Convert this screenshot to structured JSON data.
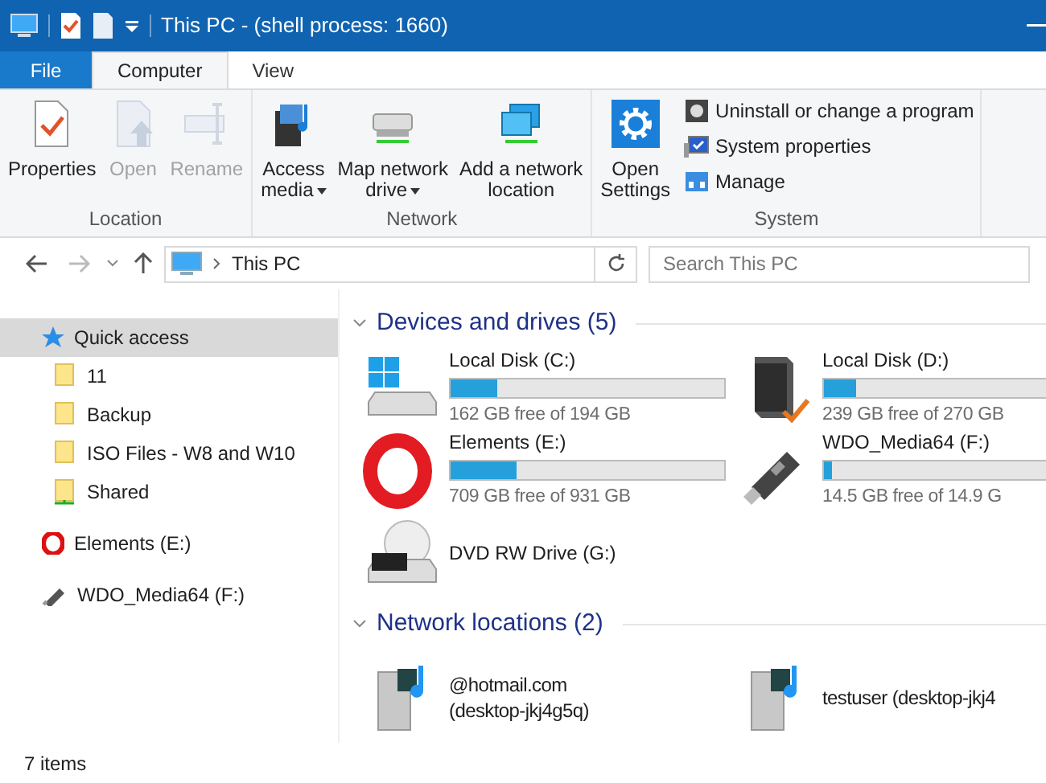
{
  "title_bar": {
    "title": "This PC - (shell process: 1660)"
  },
  "ribbon_tabs": [
    {
      "label": "File",
      "kind": "file",
      "selected": false
    },
    {
      "label": "Computer",
      "kind": "tab",
      "selected": true
    },
    {
      "label": "View",
      "kind": "tab",
      "selected": false
    }
  ],
  "ribbon_groups": [
    {
      "label": "Location",
      "buttons": [
        {
          "lines": [
            "Properties"
          ],
          "disabled": false,
          "dropdown": false
        },
        {
          "lines": [
            "Open"
          ],
          "disabled": true,
          "dropdown": false
        },
        {
          "lines": [
            "Rename"
          ],
          "disabled": true,
          "dropdown": false
        }
      ]
    },
    {
      "label": "Network",
      "buttons": [
        {
          "lines": [
            "Access",
            "media"
          ],
          "disabled": false,
          "dropdown": true
        },
        {
          "lines": [
            "Map network",
            "drive"
          ],
          "disabled": false,
          "dropdown": true
        },
        {
          "lines": [
            "Add a network",
            "location"
          ],
          "disabled": false,
          "dropdown": false
        }
      ]
    },
    {
      "label": "System",
      "buttons": [
        {
          "lines": [
            "Open",
            "Settings"
          ],
          "disabled": false,
          "dropdown": false
        }
      ],
      "small_buttons": [
        "Uninstall or change a program",
        "System properties",
        "Manage"
      ]
    }
  ],
  "address_bar": {
    "path": "This PC",
    "search_placeholder": "Search This PC"
  },
  "nav_pane": [
    {
      "label": "Quick access",
      "selected": true,
      "children": [
        {
          "label": "11",
          "selected": false
        },
        {
          "label": "Backup",
          "selected": false
        },
        {
          "label": "ISO Files - W8 and W10",
          "selected": false
        },
        {
          "label": "Shared",
          "selected": false
        }
      ]
    },
    {
      "label": "Elements (E:)",
      "selected": false
    },
    {
      "label": "WDO_Media64 (F:)",
      "selected": false
    }
  ],
  "sections": [
    {
      "title": "Devices and drives (5)",
      "items": [
        {
          "kind": "disk",
          "name": "Local Disk (C:)",
          "free": "162 GB free of 194 GB",
          "level": 0.17
        },
        {
          "kind": "disk",
          "name": "Local Disk (D:)",
          "free": "239 GB free of 270 GB",
          "level": 0.115
        },
        {
          "kind": "disk",
          "name": "Elements (E:)",
          "free": "709 GB free of 931 GB",
          "level": 0.24
        },
        {
          "kind": "disk",
          "name": "WDO_Media64 (F:)",
          "free": "14.5 GB free of 14.9 G",
          "level": 0.03
        },
        {
          "kind": "optical",
          "name": "DVD RW Drive (G:)"
        }
      ]
    },
    {
      "title": "Network locations (2)",
      "items": [
        {
          "kind": "network",
          "lines": [
            "@hotmail.com",
            "(desktop-jkj4g5q)"
          ]
        },
        {
          "kind": "network",
          "lines": [
            "testuser (desktop-jkj4"
          ]
        }
      ]
    }
  ],
  "status_bar": {
    "text": "7 items"
  }
}
